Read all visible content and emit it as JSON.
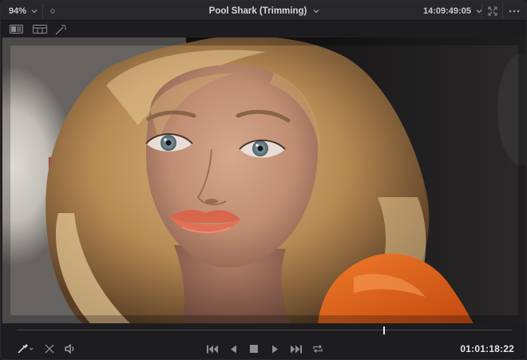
{
  "viewer": {
    "zoom_level": "94%",
    "clip_title": "Pool Shark (Trimming)",
    "source_timecode": "14:09:49:05",
    "record_timecode": "01:01:18:22",
    "playhead_position_fraction": 0.742
  },
  "icons": {
    "zoom_dropdown": "chevron-down-icon",
    "title_dropdown": "chevron-down-icon",
    "timecode_dropdown": "chevron-down-icon",
    "fullscreen": "expand-icon",
    "more": "ellipsis-icon",
    "single_viewer": "single-viewer-icon",
    "dual_viewer": "dual-viewer-icon",
    "magic_wand": "magic-wand-icon",
    "eyedropper": "eyedropper-icon",
    "bypass": "bypass-icon",
    "audio": "speaker-icon",
    "first_frame": "skip-to-start-icon",
    "play_reverse": "play-reverse-icon",
    "stop": "stop-icon",
    "play": "play-icon",
    "last_frame": "skip-to-end-icon",
    "loop": "loop-icon"
  },
  "colors": {
    "chrome_bg": "#1d1d20",
    "topbar_bg": "#28282b",
    "text": "#c9c9cc",
    "playhead": "#e6e6e8"
  }
}
